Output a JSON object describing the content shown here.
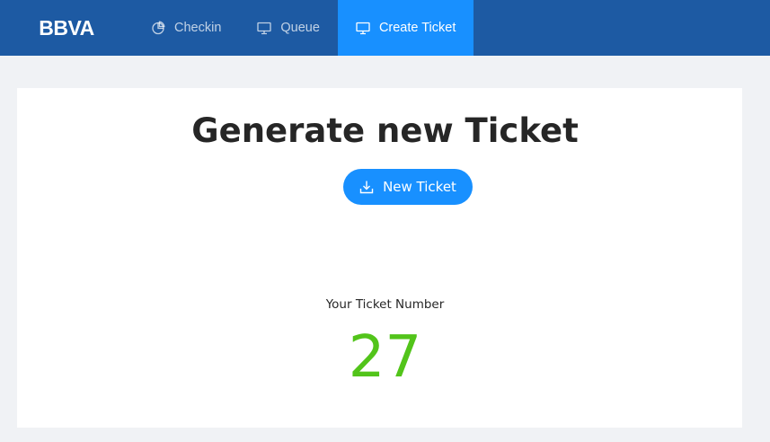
{
  "navbar": {
    "logo_text": "BBVA",
    "items": [
      {
        "label": "Checkin",
        "icon": "pie-chart-icon",
        "active": false
      },
      {
        "label": "Queue",
        "icon": "desktop-icon",
        "active": false
      },
      {
        "label": "Create Ticket",
        "icon": "desktop-icon",
        "active": true
      }
    ]
  },
  "main": {
    "title": "Generate new Ticket",
    "new_ticket_button": {
      "label": "New Ticket",
      "icon": "download-icon"
    },
    "ticket_label": "Your Ticket Number",
    "ticket_number": "27"
  },
  "colors": {
    "navbar_bg": "#1d5aa3",
    "active_tab_bg": "#1890ff",
    "button_bg": "#1890ff",
    "ticket_number": "#52c41a",
    "page_bg": "#f0f2f5"
  }
}
